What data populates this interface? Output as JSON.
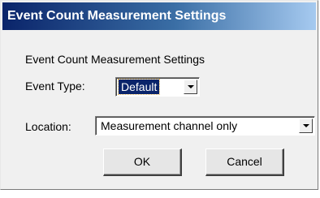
{
  "window": {
    "title": "Event Count Measurement Settings"
  },
  "content": {
    "heading": "Event Count Measurement Settings",
    "event_type": {
      "label": "Event Type:",
      "selected": "Default"
    },
    "location": {
      "label": "Location:",
      "selected": "Measurement channel only"
    }
  },
  "buttons": {
    "ok": "OK",
    "cancel": "Cancel"
  },
  "icons": {
    "dropdown": "chevron-down-icon"
  },
  "colors": {
    "title_bar_start": "#0a246a",
    "title_bar_end": "#a6caf0",
    "selection": "#0a246a",
    "dialog_bg": "#f0f0f0"
  }
}
